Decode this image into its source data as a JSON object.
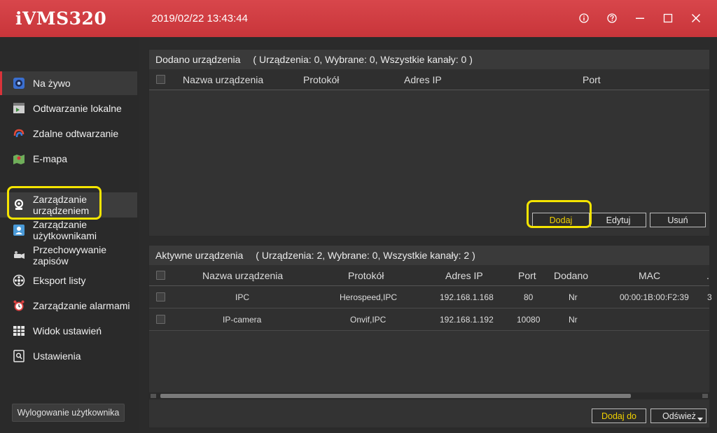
{
  "titlebar": {
    "app_title": "iVMS320",
    "datetime": "2019/02/22 13:43:44"
  },
  "sidebar": {
    "items": [
      {
        "label": "Na żywo",
        "icon": "live-view-icon"
      },
      {
        "label": "Odtwarzanie lokalne",
        "icon": "local-playback-icon"
      },
      {
        "label": "Zdalne odtwarzanie",
        "icon": "remote-playback-icon"
      },
      {
        "label": "E-mapa",
        "icon": "emap-icon"
      },
      {
        "label": "Zarządzanie urządzeniem",
        "icon": "device-management-icon"
      },
      {
        "label": "Zarządzanie użytkownikami",
        "icon": "user-management-icon"
      },
      {
        "label": "Przechowywanie zapisów",
        "icon": "recording-storage-icon"
      },
      {
        "label": "Eksport listy",
        "icon": "list-export-icon"
      },
      {
        "label": "Zarządzanie alarmami",
        "icon": "alarm-clock-icon"
      },
      {
        "label": "Widok ustawień",
        "icon": "layout-settings-icon"
      },
      {
        "label": "Ustawienia",
        "icon": "settings-icon"
      }
    ],
    "logout_label": "Wylogowanie użytkownika"
  },
  "added_devices": {
    "title": "Dodano urządzenia",
    "counts": "( Urządzenia: 0, Wybrane: 0, Wszystkie kanały: 0 )",
    "columns": [
      "Nazwa urządzenia",
      "Protokół",
      "Adres IP",
      "Port"
    ],
    "buttons": {
      "add": "Dodaj",
      "edit": "Edytuj",
      "delete": "Usuń"
    }
  },
  "active_devices": {
    "title": "Aktywne urządzenia",
    "counts": "( Urządzenia: 2, Wybrane: 0, Wszystkie kanały: 2 )",
    "columns": [
      "Nazwa urządzenia",
      "Protokół",
      "Adres IP",
      "Port",
      "Dodano",
      "MAC",
      "."
    ],
    "rows": [
      {
        "name": "IPC",
        "protocol": "Herospeed,IPC",
        "ip": "192.168.1.168",
        "port": "80",
        "added": "Nr",
        "mac": "00:00:1B:00:F2:39",
        "extra": "3"
      },
      {
        "name": "IP-camera",
        "protocol": "Onvif,IPC",
        "ip": "192.168.1.192",
        "port": "10080",
        "added": "Nr",
        "mac": "",
        "extra": ""
      }
    ],
    "buttons": {
      "add_to": "Dodaj do",
      "refresh": "Odśwież"
    }
  },
  "colors": {
    "accent_red": "#d23c41",
    "highlight_yellow": "#f5e500",
    "button_yellow_text": "#f0d000"
  }
}
